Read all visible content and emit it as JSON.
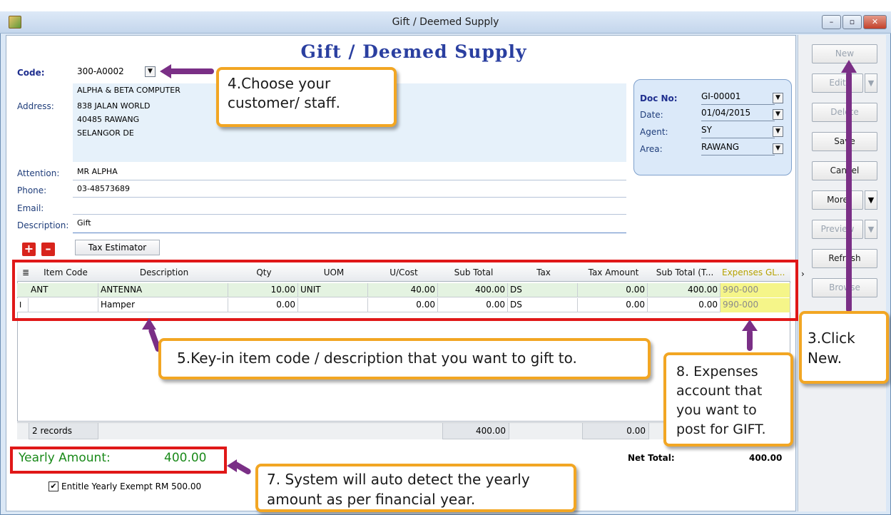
{
  "window": {
    "title": "Gift / Deemed Supply",
    "controls": [
      "–",
      "▫",
      "✕"
    ]
  },
  "form": {
    "heading": "Gift / Deemed Supply",
    "code_label": "Code:",
    "code_value": "300-A0002",
    "company_name": "ALPHA & BETA COMPUTER",
    "address_label": "Address:",
    "address_lines": [
      "838 JALAN WORLD",
      "40485 RAWANG",
      "SELANGOR DE"
    ],
    "attention_label": "Attention:",
    "attention_value": "MR ALPHA",
    "phone_label": "Phone:",
    "phone_value": "03-48573689",
    "email_label": "Email:",
    "email_value": "",
    "description_label": "Description:",
    "description_value": "Gift",
    "tax_estimator": "Tax Estimator"
  },
  "doc": {
    "docno_label": "Doc No:",
    "docno_value": "GI-00001",
    "date_label": "Date:",
    "date_value": "01/04/2015",
    "agent_label": "Agent:",
    "agent_value": "SY",
    "area_label": "Area:",
    "area_value": "RAWANG"
  },
  "sidebar": {
    "new": "New",
    "edit": "Edit",
    "delete": "Delete",
    "save": "Save",
    "cancel": "Cancel",
    "more": "More",
    "preview": "Preview",
    "refresh": "Refresh",
    "browse": "Browse"
  },
  "grid": {
    "headers": [
      "Item Code",
      "Description",
      "Qty",
      "UOM",
      "U/Cost",
      "Sub Total",
      "Tax",
      "Tax Amount",
      "Sub Total (T...",
      "Expenses GL..."
    ],
    "rows": [
      [
        "ANT",
        "ANTENNA",
        "10.00",
        "UNIT",
        "40.00",
        "400.00",
        "DS",
        "0.00",
        "400.00",
        "990-000"
      ],
      [
        "",
        "Hamper",
        "0.00",
        "",
        "0.00",
        "0.00",
        "DS",
        "0.00",
        "0.00",
        "990-000"
      ]
    ],
    "records": "2 records",
    "footer_subtotal": "400.00",
    "footer_tax": "0.00"
  },
  "yearly": {
    "label": "Yearly Amount:",
    "value": "400.00",
    "checkbox_label": "Entitle Yearly Exempt RM 500.00",
    "checked": true
  },
  "totals": {
    "net_label": "Net Total:",
    "net_value": "400.00"
  },
  "callouts": {
    "c3": "3.Click New.",
    "c4": "4.Choose your customer/ staff.",
    "c5": "5.Key-in item code / description that you want to gift to.",
    "c7": "7. System will auto detect the yearly amount as per financial year.",
    "c8": "8. Expenses account that you want to post for GIFT."
  }
}
